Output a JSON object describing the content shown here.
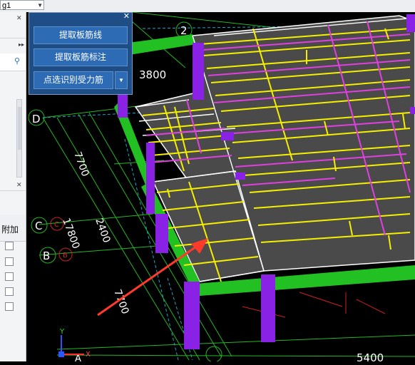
{
  "toolbar": {
    "floor_value": "g1"
  },
  "floating_panel": {
    "btn_extract_lines": "提取板筋线",
    "btn_extract_labels": "提取板筋标注",
    "btn_pick_identify": "点选识别受力筋"
  },
  "left_panel": {
    "column_header": "附加"
  },
  "drawing": {
    "axis_d": "D",
    "axis_c": "C",
    "axis_b": "B",
    "axis_c_sub": "C",
    "axis_b_sub": "B",
    "axis_2": "2",
    "axis_a": "A",
    "dim_3800": "3800",
    "dim_7700_top": "7700",
    "dim_17800": "17800",
    "dim_2400": "2400",
    "dim_7700_bottom": "7700",
    "dim_bottom_right": "5400"
  },
  "colors": {
    "slab_rebar_yellow": "#f5f000",
    "slab_rebar_magenta": "#e040e0",
    "beam_green": "#22c022",
    "column_purple": "#8020e0",
    "slab_gray": "#505050",
    "annotation_arrow": "#ff3a2a"
  }
}
